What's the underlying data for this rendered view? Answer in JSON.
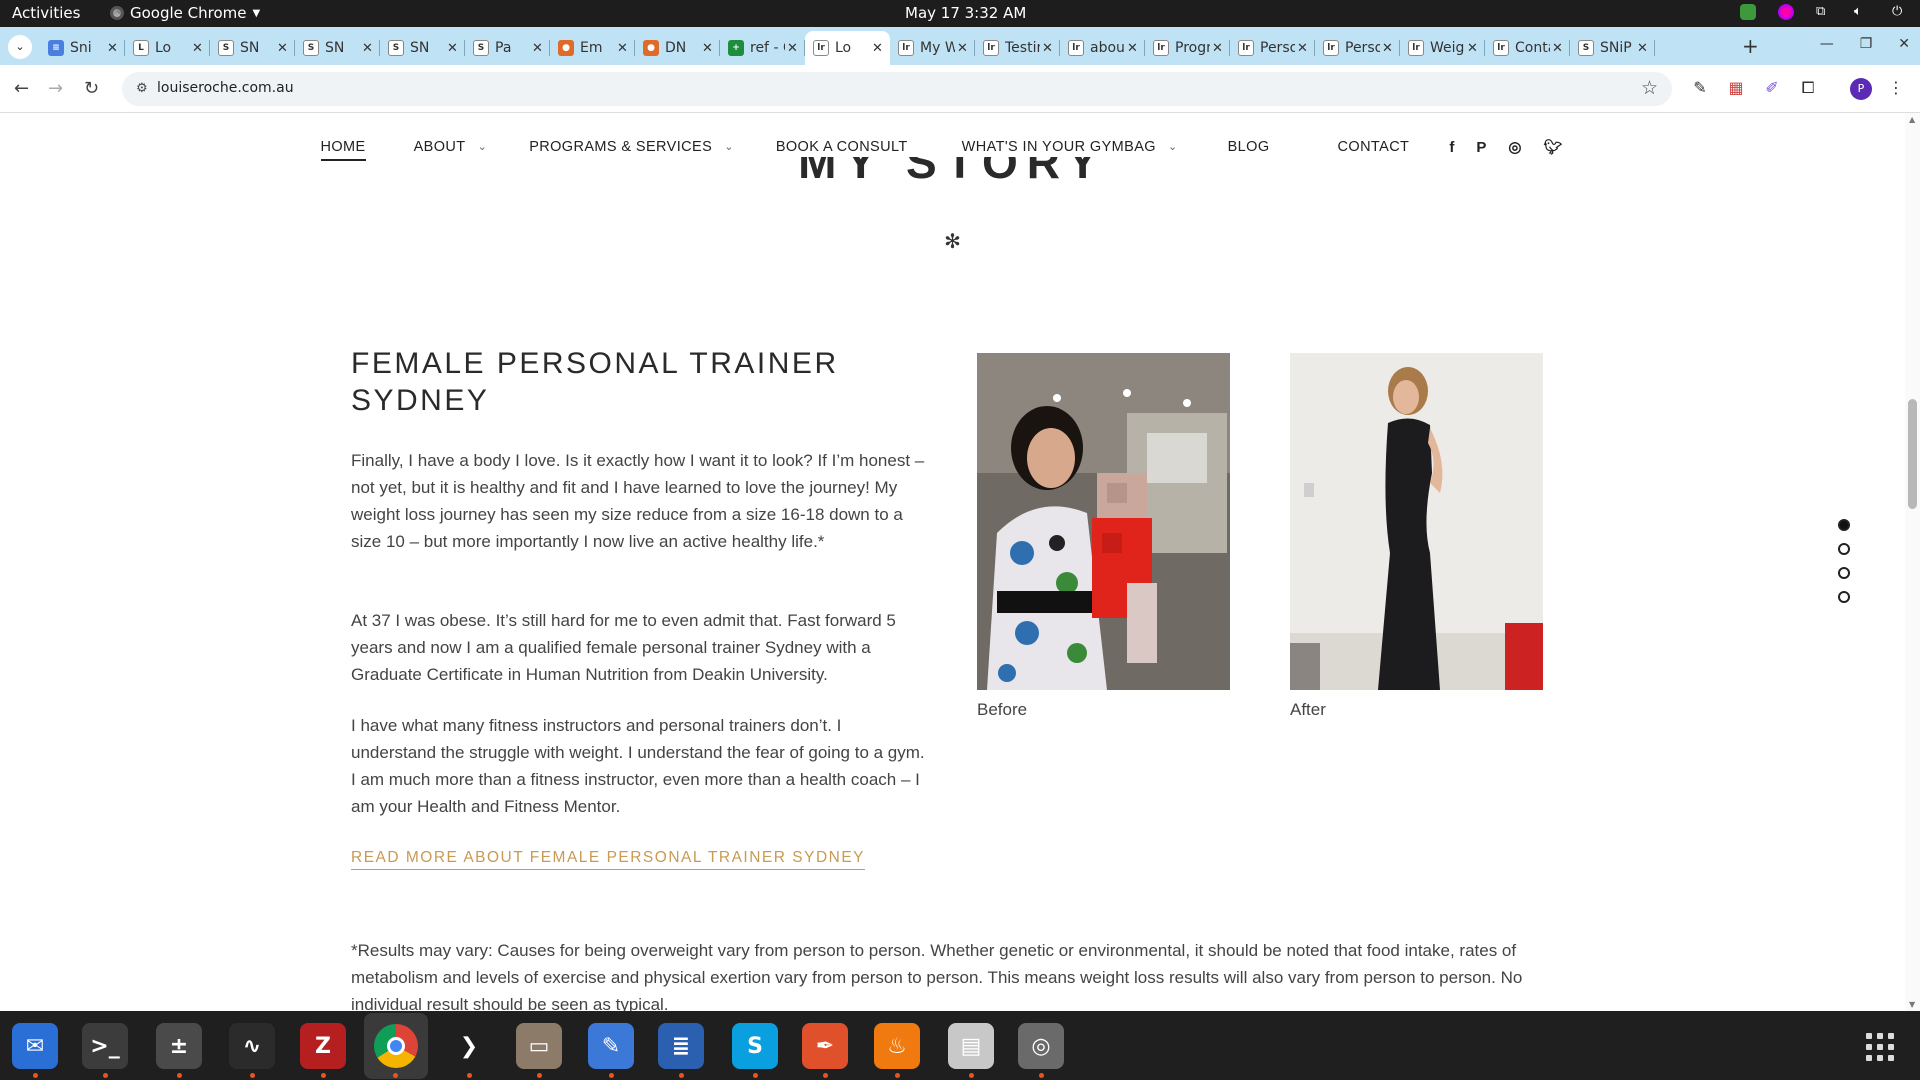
{
  "topbar": {
    "activities": "Activities",
    "app_name": "Google Chrome",
    "clock": "May 17  3:32 AM"
  },
  "tabs": [
    {
      "title": "Sni",
      "favicon": "docs-icon",
      "color": "#4a7fe0",
      "glyph": "≡"
    },
    {
      "title": "Lo",
      "favicon": "letter-l-icon",
      "color": "#ffffff",
      "glyph": "L"
    },
    {
      "title": "SN",
      "favicon": "snip-icon",
      "color": "#ffffff",
      "glyph": "S"
    },
    {
      "title": "SN",
      "favicon": "snip-icon",
      "color": "#ffffff",
      "glyph": "S"
    },
    {
      "title": "SN",
      "favicon": "snip-icon",
      "color": "#ffffff",
      "glyph": "S"
    },
    {
      "title": "Pa",
      "favicon": "snip-icon",
      "color": "#ffffff",
      "glyph": "S"
    },
    {
      "title": "Em",
      "favicon": "colorful-icon",
      "color": "#e06a2a",
      "glyph": "●"
    },
    {
      "title": "DN",
      "favicon": "colorful-icon",
      "color": "#e06a2a",
      "glyph": "●"
    },
    {
      "title": "ref - G",
      "favicon": "sheets-icon",
      "color": "#1e8e3e",
      "glyph": "+"
    },
    {
      "title": "Lo",
      "favicon": "site-icon",
      "color": "#ffffff",
      "glyph": "lr",
      "active": true
    },
    {
      "title": "My W",
      "favicon": "site-icon",
      "color": "#ffffff",
      "glyph": "lr"
    },
    {
      "title": "Testin",
      "favicon": "site-icon",
      "color": "#ffffff",
      "glyph": "lr"
    },
    {
      "title": "about",
      "favicon": "site-icon",
      "color": "#ffffff",
      "glyph": "lr"
    },
    {
      "title": "Progr",
      "favicon": "site-icon",
      "color": "#ffffff",
      "glyph": "lr"
    },
    {
      "title": "Perso",
      "favicon": "site-icon",
      "color": "#ffffff",
      "glyph": "lr"
    },
    {
      "title": "Perso",
      "favicon": "site-icon",
      "color": "#ffffff",
      "glyph": "lr"
    },
    {
      "title": "Weigh",
      "favicon": "site-icon",
      "color": "#ffffff",
      "glyph": "lr"
    },
    {
      "title": "Conta",
      "favicon": "site-icon",
      "color": "#ffffff",
      "glyph": "lr"
    },
    {
      "title": "SNiP N",
      "favicon": "snip-icon",
      "color": "#ffffff",
      "glyph": "S"
    }
  ],
  "toolbar": {
    "url": "louiseroche.com.au",
    "profile_initial": "P"
  },
  "nav": {
    "items": [
      {
        "label": "HOME",
        "active": true,
        "dropdown": false
      },
      {
        "label": "ABOUT",
        "active": false,
        "dropdown": true
      },
      {
        "label": "PROGRAMS & SERVICES",
        "active": false,
        "dropdown": true
      },
      {
        "label": "BOOK A CONSULT",
        "active": false,
        "dropdown": false
      },
      {
        "label": "WHAT'S IN YOUR GYMBAG",
        "active": false,
        "dropdown": true
      },
      {
        "label": "BLOG",
        "active": false,
        "dropdown": false
      },
      {
        "label": "CONTACT",
        "active": false,
        "dropdown": false
      }
    ],
    "social": [
      "facebook-icon",
      "pinterest-icon",
      "instagram-icon",
      "twitter-icon"
    ]
  },
  "page": {
    "section_heading": "MY STORY",
    "asterisk": "✻",
    "title": "FEMALE PERSONAL TRAINER SYDNEY",
    "paragraphs": [
      "Finally, I have a body I love. Is it exactly how I want it to look? If I’m honest – not yet, but it is healthy and fit and I have learned to love the journey! My weight loss journey has seen my size reduce from a size 16-18 down to a size 10 – but more importantly I now live an active healthy life.*",
      "At 37 I was obese. It’s still hard for me to even admit that. Fast forward 5 years and now I am a qualified female personal trainer Sydney with a Graduate Certificate in Human Nutrition from Deakin University.",
      "I have what many fitness instructors and personal trainers don’t. I understand the struggle with weight. I understand the fear of going to a gym. I am much more than a fitness instructor, even more than a health coach – I am your Health and Fitness Mentor."
    ],
    "read_more": "READ MORE ABOUT FEMALE PERSONAL TRAINER SYDNEY",
    "before_caption": "Before",
    "after_caption": "After",
    "footnote": "*Results may vary: Causes for being overweight vary from person to person. Whether genetic or environmental, it should be noted that food intake, rates of metabolism and levels of exercise and physical exertion vary from person to person. This means weight loss results will also vary from person to person. No individual result should be seen as typical.",
    "slide_dots": 4,
    "active_dot": 0
  },
  "dock": [
    {
      "name": "thunderbird-icon",
      "color": "#2a6fd6",
      "glyph": "✉"
    },
    {
      "name": "terminal-icon",
      "color": "#3c3c3c",
      "glyph": ">_"
    },
    {
      "name": "calculator-icon",
      "color": "#4a4a4a",
      "glyph": "±"
    },
    {
      "name": "system-monitor-icon",
      "color": "#2b2b2b",
      "glyph": "∿"
    },
    {
      "name": "filezilla-icon",
      "color": "#b51f1f",
      "glyph": "Z"
    },
    {
      "name": "chrome-icon",
      "color": "#3a3a3a",
      "glyph": "◉",
      "selected": true
    },
    {
      "name": "vscode-icon",
      "color": "#1f1f1f",
      "glyph": "❯"
    },
    {
      "name": "files-icon",
      "color": "#8c7b68",
      "glyph": "▭"
    },
    {
      "name": "text-editor-icon",
      "color": "#3b78d8",
      "glyph": "✎"
    },
    {
      "name": "document-viewer-icon",
      "color": "#2b5fb0",
      "glyph": "≣"
    },
    {
      "name": "skype-icon",
      "color": "#0aa0e0",
      "glyph": "S"
    },
    {
      "name": "inkscape-icon",
      "color": "#e0502a",
      "glyph": "✒"
    },
    {
      "name": "blaze-icon",
      "color": "#f07a10",
      "glyph": "♨"
    },
    {
      "name": "document-scanner-icon",
      "color": "#c8c8c8",
      "glyph": "▤"
    },
    {
      "name": "disk-icon",
      "color": "#6a6a6a",
      "glyph": "◎"
    }
  ],
  "colors": {
    "accent_link": "#c89a52",
    "tabstrip": "#bfe3f5",
    "text": "#444444"
  }
}
